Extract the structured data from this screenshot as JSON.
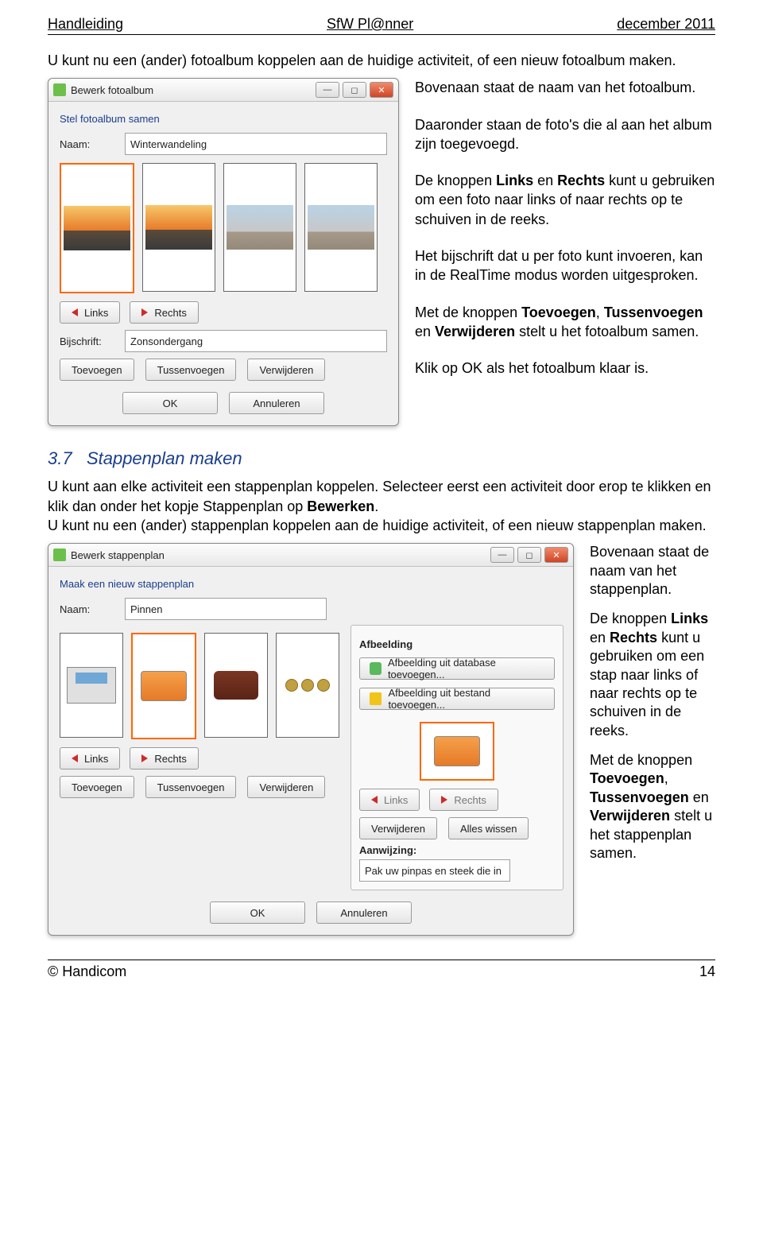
{
  "header": {
    "left": "Handleiding",
    "center": "SfW Pl@nner",
    "right": "december 2011"
  },
  "intro1": "U kunt nu een (ander) fotoalbum koppelen aan de huidige activiteit, of een nieuw fotoalbum maken.",
  "window1": {
    "title": "Bewerk fotoalbum",
    "group_title": "Stel fotoalbum samen",
    "name_label": "Naam:",
    "name_value": "Winterwandeling",
    "caption_label": "Bijschrift:",
    "caption_value": "Zonsondergang",
    "btn_links": "Links",
    "btn_rechts": "Rechts",
    "btn_toevoegen": "Toevoegen",
    "btn_tussenvoegen": "Tussenvoegen",
    "btn_verwijderen": "Verwijderen",
    "btn_ok": "OK",
    "btn_annuleren": "Annuleren"
  },
  "side1": {
    "p1": "Bovenaan staat de naam van het fotoalbum.",
    "p2": "Daaronder staan de foto's die al aan het album zijn toegevoegd.",
    "p3_a": "De knoppen ",
    "p3_b1": "Links",
    "p3_m": " en ",
    "p3_b2": "Rechts",
    "p3_c": " kunt u gebruiken om een foto naar links of naar rechts op te schuiven in de reeks.",
    "p4": "Het bijschrift dat u per foto kunt invoeren, kan in de RealTime modus worden uitgesproken.",
    "p5_a": "Met de knoppen ",
    "p5_b1": "Toevoegen",
    "p5_m1": ", ",
    "p5_b2": "Tussenvoegen",
    "p5_m2": " en ",
    "p5_b3": "Verwijderen",
    "p5_c": " stelt u het fotoalbum samen.",
    "p6": "Klik op OK als het fotoalbum klaar is."
  },
  "section": {
    "num": "3.7",
    "title": "Stappenplan maken"
  },
  "intro2_a": "U kunt aan elke activiteit een stappenplan koppelen. Selecteer eerst een activiteit door erop te klikken en klik dan onder het kopje Stappenplan op ",
  "intro2_bold": "Bewerken",
  "intro2_b": ".\nU kunt nu een (ander) stappenplan koppelen aan de huidige activiteit, of een nieuw stappenplan maken.",
  "window2": {
    "title": "Bewerk stappenplan",
    "group_title": "Maak een nieuw stappenplan",
    "name_label": "Naam:",
    "name_value": "Pinnen",
    "img_label": "Afbeelding",
    "btn_img_db": "Afbeelding uit database toevoegen...",
    "btn_img_file": "Afbeelding uit bestand toevoegen...",
    "btn_links": "Links",
    "btn_rechts": "Rechts",
    "btn_verwijderen": "Verwijderen",
    "btn_alles_wissen": "Alles wissen",
    "hint_label": "Aanwijzing:",
    "hint_value": "Pak uw pinpas en steek die in de automaat.",
    "btn_toevoegen": "Toevoegen",
    "btn_tussenvoegen": "Tussenvoegen",
    "btn_ok": "OK",
    "btn_annuleren": "Annuleren"
  },
  "side2": {
    "p1": "Bovenaan staat de naam van het stappenplan.",
    "p2_a": "De knoppen ",
    "p2_b1": "Links",
    "p2_m": " en ",
    "p2_b2": "Rechts",
    "p2_c": " kunt u gebruiken om een stap naar links of naar rechts op te schuiven in de reeks.",
    "p3_a": "Met de knoppen ",
    "p3_b1": "Toevoegen",
    "p3_m1": ", ",
    "p3_b2": "Tussenvoegen",
    "p3_m2": " en ",
    "p3_b3": "Verwijderen",
    "p3_c": " stelt u het stappenplan samen."
  },
  "footer": {
    "left": "© Handicom",
    "right": "14"
  }
}
